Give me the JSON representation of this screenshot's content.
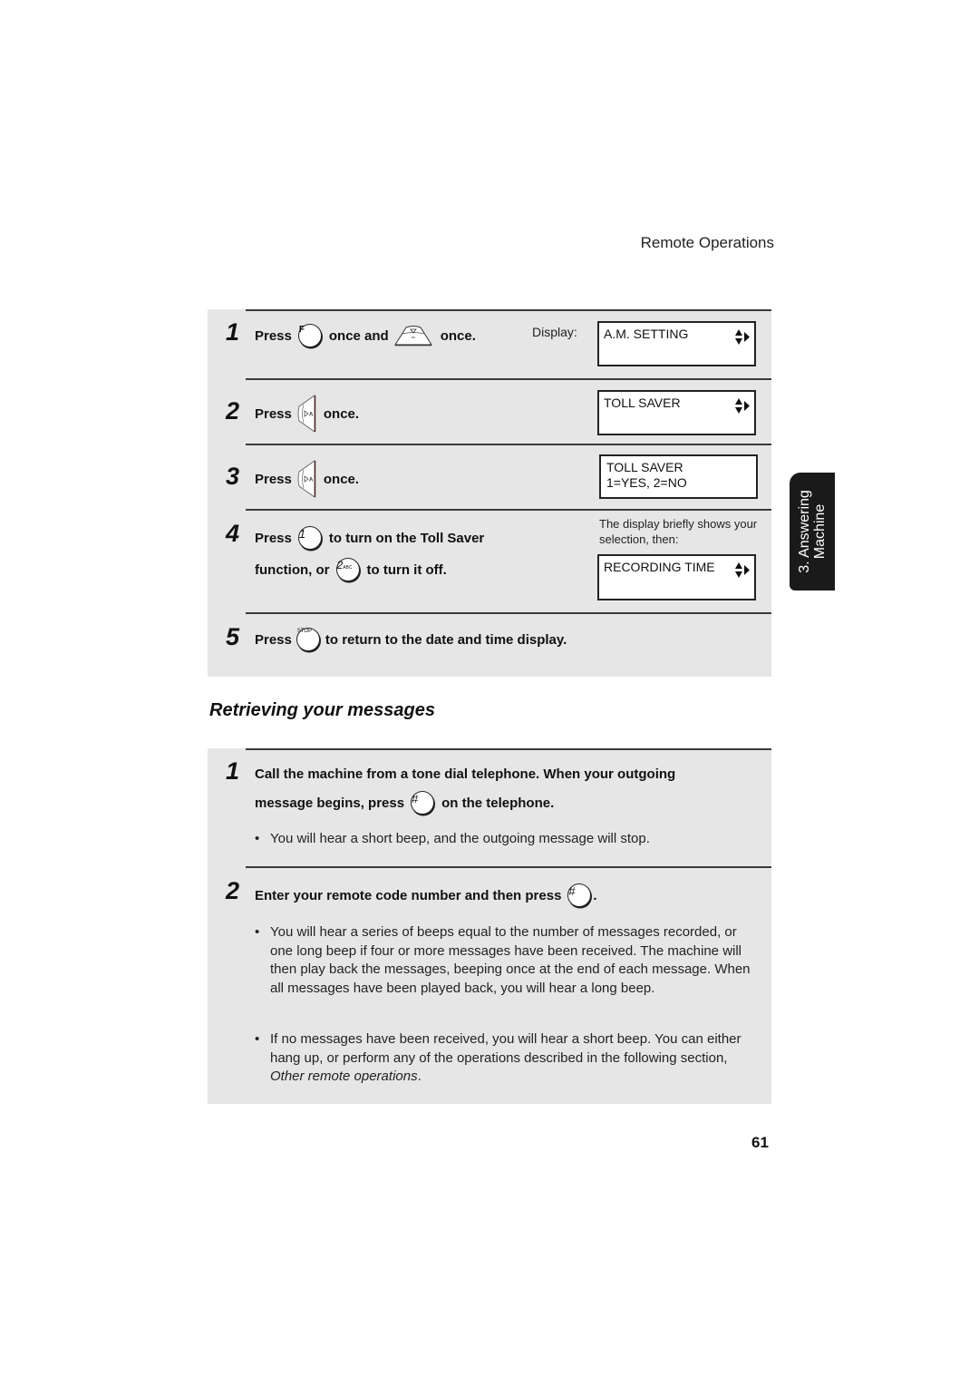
{
  "header": {
    "section": "Remote Operations"
  },
  "toll_saver_steps": {
    "display_label": "Display:",
    "steps": [
      {
        "num": "1",
        "text_a": "Press",
        "key_a": "F",
        "text_b": "once and",
        "text_c": "once.",
        "lcd_line1": "A.M. SETTING",
        "lcd_line2": ""
      },
      {
        "num": "2",
        "text_a": "Press",
        "text_b": "once.",
        "lcd_line1": "TOLL SAVER",
        "lcd_line2": ""
      },
      {
        "num": "3",
        "text_a": "Press",
        "text_b": "once.",
        "lcd_line1": "TOLL SAVER",
        "lcd_line2": "1=YES, 2=NO"
      },
      {
        "num": "4",
        "text_a": "Press",
        "key_a": "1",
        "text_b": "to turn on the Toll Saver",
        "text_c": "function, or",
        "key_b": "2",
        "key_b_sub": "ABC",
        "text_d": "to turn it off.",
        "note": "The display briefly shows your selection, then:",
        "lcd_line1": "RECORDING TIME",
        "lcd_line2": ""
      },
      {
        "num": "5",
        "text_a": "Press",
        "key_a": "STOP",
        "text_b": "to return to the date and time display."
      }
    ]
  },
  "retrieving": {
    "title": "Retrieving your messages",
    "steps": [
      {
        "num": "1",
        "line1": "Call the machine from a tone dial telephone. When your outgoing",
        "line2_a": "message begins, press",
        "key": "#",
        "line2_b": "on the telephone.",
        "bullets": [
          "You will hear a short beep, and the outgoing message will stop."
        ]
      },
      {
        "num": "2",
        "text_a": "Enter your remote code number and then press",
        "key": "#",
        "text_b": ".",
        "bullets": [
          "You will hear a series of beeps equal to the number of messages recorded, or one long beep if four or more messages have been received. The machine will then play back the messages, beeping once at the end of each message. When all messages have been played back, you will hear a long beep.",
          "If no messages have been received, you will hear a short beep. You can either hang up, or perform any of the operations described in the following section,"
        ],
        "bullet_2_italic": "Other remote operations",
        "bullet_2_end": "."
      }
    ]
  },
  "side_tab": {
    "line1": "3. Answering",
    "line2": "Machine"
  },
  "page_number": "61",
  "icons": {
    "lcd_arrows": "up-down-right-arrows-icon",
    "nav_down_key": "nav-down-key-icon",
    "nav_right_key": "nav-right-key-icon"
  }
}
